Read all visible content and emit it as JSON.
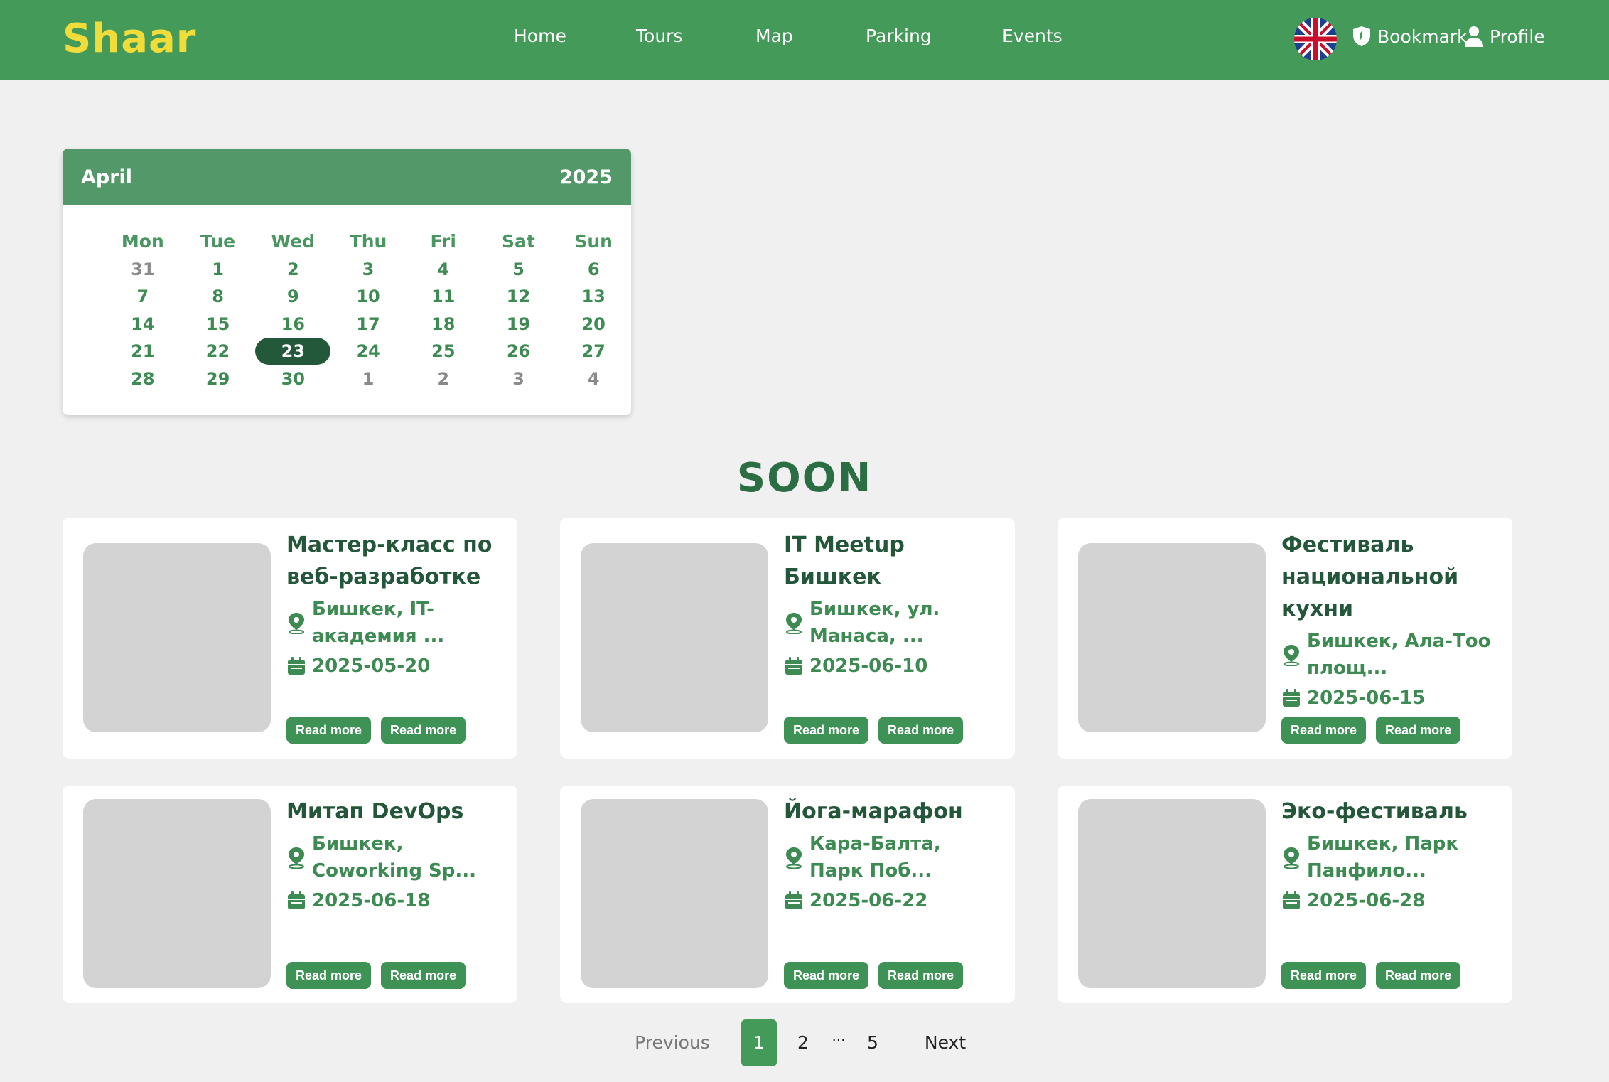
{
  "header": {
    "logo": "Shaar",
    "nav": [
      "Home",
      "Tours",
      "Map",
      "Parking",
      "Events"
    ],
    "bookmark_label": "Bookmark",
    "profile_label": "Profile",
    "language_icon": "uk-flag-icon"
  },
  "calendar": {
    "month": "April",
    "year": "2025",
    "weekdays": [
      "Mon",
      "Tue",
      "Wed",
      "Thu",
      "Fri",
      "Sat",
      "Sun"
    ],
    "weeks": [
      [
        "31",
        "1",
        "2",
        "3",
        "4",
        "5",
        "6"
      ],
      [
        "7",
        "8",
        "9",
        "10",
        "11",
        "12",
        "13"
      ],
      [
        "14",
        "15",
        "16",
        "17",
        "18",
        "19",
        "20"
      ],
      [
        "21",
        "22",
        "23",
        "24",
        "25",
        "26",
        "27"
      ],
      [
        "28",
        "29",
        "30",
        "1",
        "2",
        "3",
        "4"
      ]
    ],
    "selected_day": "23"
  },
  "section_title": "SOON",
  "events": [
    {
      "title": "Мастер-класс по веб-разработке",
      "location": "Бишкек, IT-академия ...",
      "date": "2025-05-20",
      "button1": "Read more",
      "button2": "Read more"
    },
    {
      "title": "IT Meetup Бишкек",
      "location": "Бишкек, ул. Манаса, ...",
      "date": "2025-06-10",
      "button1": "Read more",
      "button2": "Read more"
    },
    {
      "title": "Фестиваль национальной кухни",
      "location": "Бишкек, Ала-Тоо площ...",
      "date": "2025-06-15",
      "button1": "Read more",
      "button2": "Read more"
    },
    {
      "title": "Митап DevOps",
      "location": "Бишкек, Coworking Sp...",
      "date": "2025-06-18",
      "button1": "Read more",
      "button2": "Read more"
    },
    {
      "title": "Йога-марафон",
      "location": "Кара-Балта, Парк Поб...",
      "date": "2025-06-22",
      "button1": "Read more",
      "button2": "Read more"
    },
    {
      "title": "Эко-фестиваль",
      "location": "Бишкек, Парк Панфило...",
      "date": "2025-06-28",
      "button1": "Read more",
      "button2": "Read more"
    }
  ],
  "pagination": {
    "previous": "Previous",
    "pages": [
      "1",
      "2",
      "...",
      "5"
    ],
    "current": "1",
    "next": "Next"
  },
  "colors": {
    "header_bg": "#449a58",
    "logo": "#f2dc3a",
    "accent_dark": "#23593a",
    "placeholder": "#d3d3d3"
  }
}
